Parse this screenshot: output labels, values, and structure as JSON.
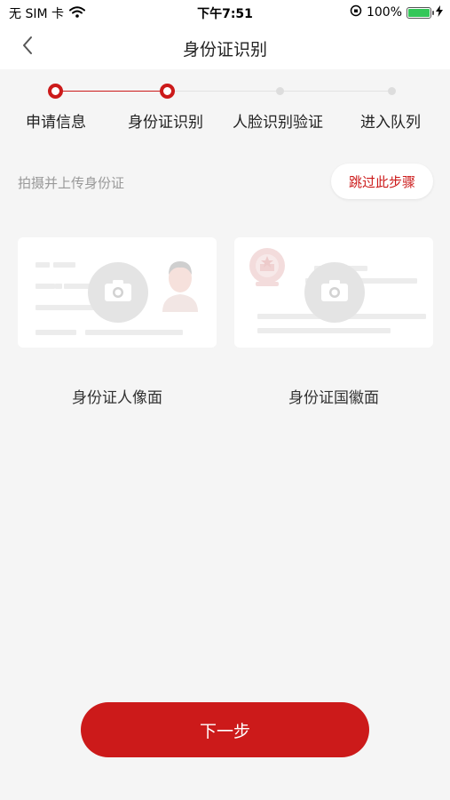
{
  "status_bar": {
    "carrier": "无 SIM 卡",
    "time": "下午7:51",
    "battery_percent": "100%",
    "battery_level": 1.0
  },
  "nav": {
    "title": "身份证识别",
    "back_icon": "chevron-left-icon"
  },
  "steps": [
    {
      "label": "申请信息",
      "state": "done"
    },
    {
      "label": "身份证识别",
      "state": "current"
    },
    {
      "label": "人脸识别验证",
      "state": "todo"
    },
    {
      "label": "进入队列",
      "state": "todo"
    }
  ],
  "hint_text": "拍摄并上传身份证",
  "skip_label": "跳过此步骤",
  "cards": [
    {
      "label": "身份证人像面",
      "icon": "camera-icon"
    },
    {
      "label": "身份证国徽面",
      "icon": "camera-icon"
    }
  ],
  "next_label": "下一步",
  "colors": {
    "accent": "#cc1a1a",
    "background": "#f5f5f5"
  }
}
